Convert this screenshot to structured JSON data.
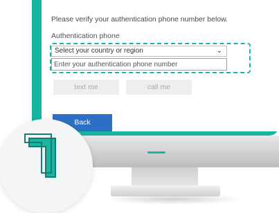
{
  "verify": {
    "instruction": "Please verify your authentication phone number below.",
    "field_label": "Authentication phone",
    "country_select": "Select your country or region",
    "phone_placeholder": "Enter your authentication phone number",
    "text_me": "text me",
    "call_me": "call me",
    "back": "Back"
  },
  "step_badge": {
    "icon": "number-seven-icon"
  },
  "colors": {
    "monitor_frame": "#17b3a3",
    "dash_highlight": "#19b3a5",
    "back_button": "#2d6fc4",
    "disabled_button": "#eeeeee"
  }
}
